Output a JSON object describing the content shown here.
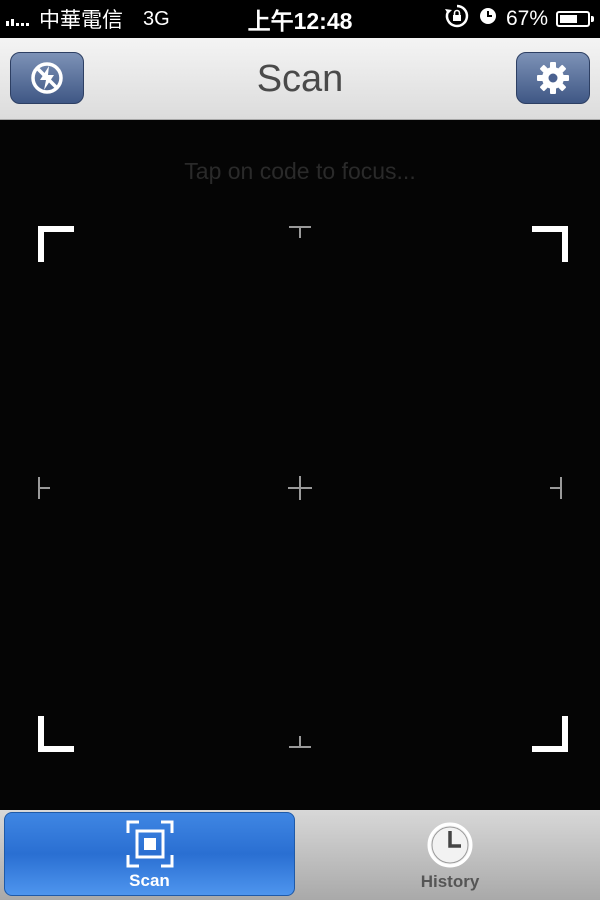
{
  "status_bar": {
    "carrier": "中華電信",
    "network": "3G",
    "time": "上午12:48",
    "battery": "67%",
    "battery_level": 0.67
  },
  "nav": {
    "title": "Scan",
    "left_icon": "flash-off-icon",
    "right_icon": "gear-icon"
  },
  "scanner": {
    "hint": "Tap on code to focus..."
  },
  "tabs": [
    {
      "label": "Scan",
      "icon": "scan-frame-icon",
      "active": true
    },
    {
      "label": "History",
      "icon": "clock-icon",
      "active": false
    }
  ]
}
